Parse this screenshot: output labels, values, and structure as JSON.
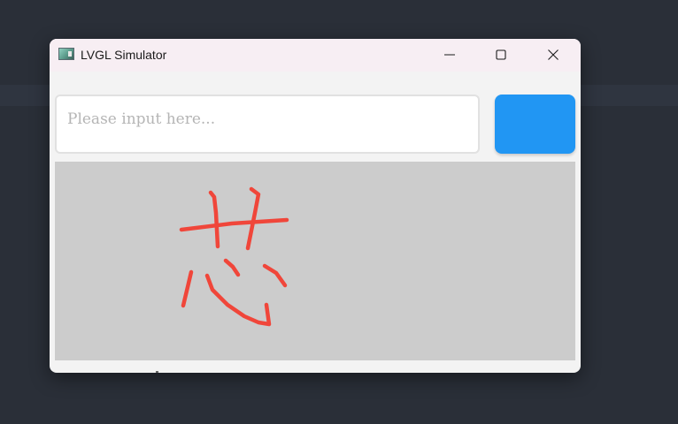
{
  "window": {
    "title": "LVGL Simulator",
    "icon": "lvgl-app-icon",
    "controls": {
      "minimize_icon": "minimize-icon",
      "maximize_icon": "maximize-icon",
      "close_icon": "close-icon"
    }
  },
  "textarea": {
    "placeholder": "Please input here..."
  },
  "button": {
    "label": "",
    "color": "#2196f3"
  },
  "canvas": {
    "background": "#cccccc",
    "stroke_color": "#f0463a",
    "handwriting": "芯"
  }
}
